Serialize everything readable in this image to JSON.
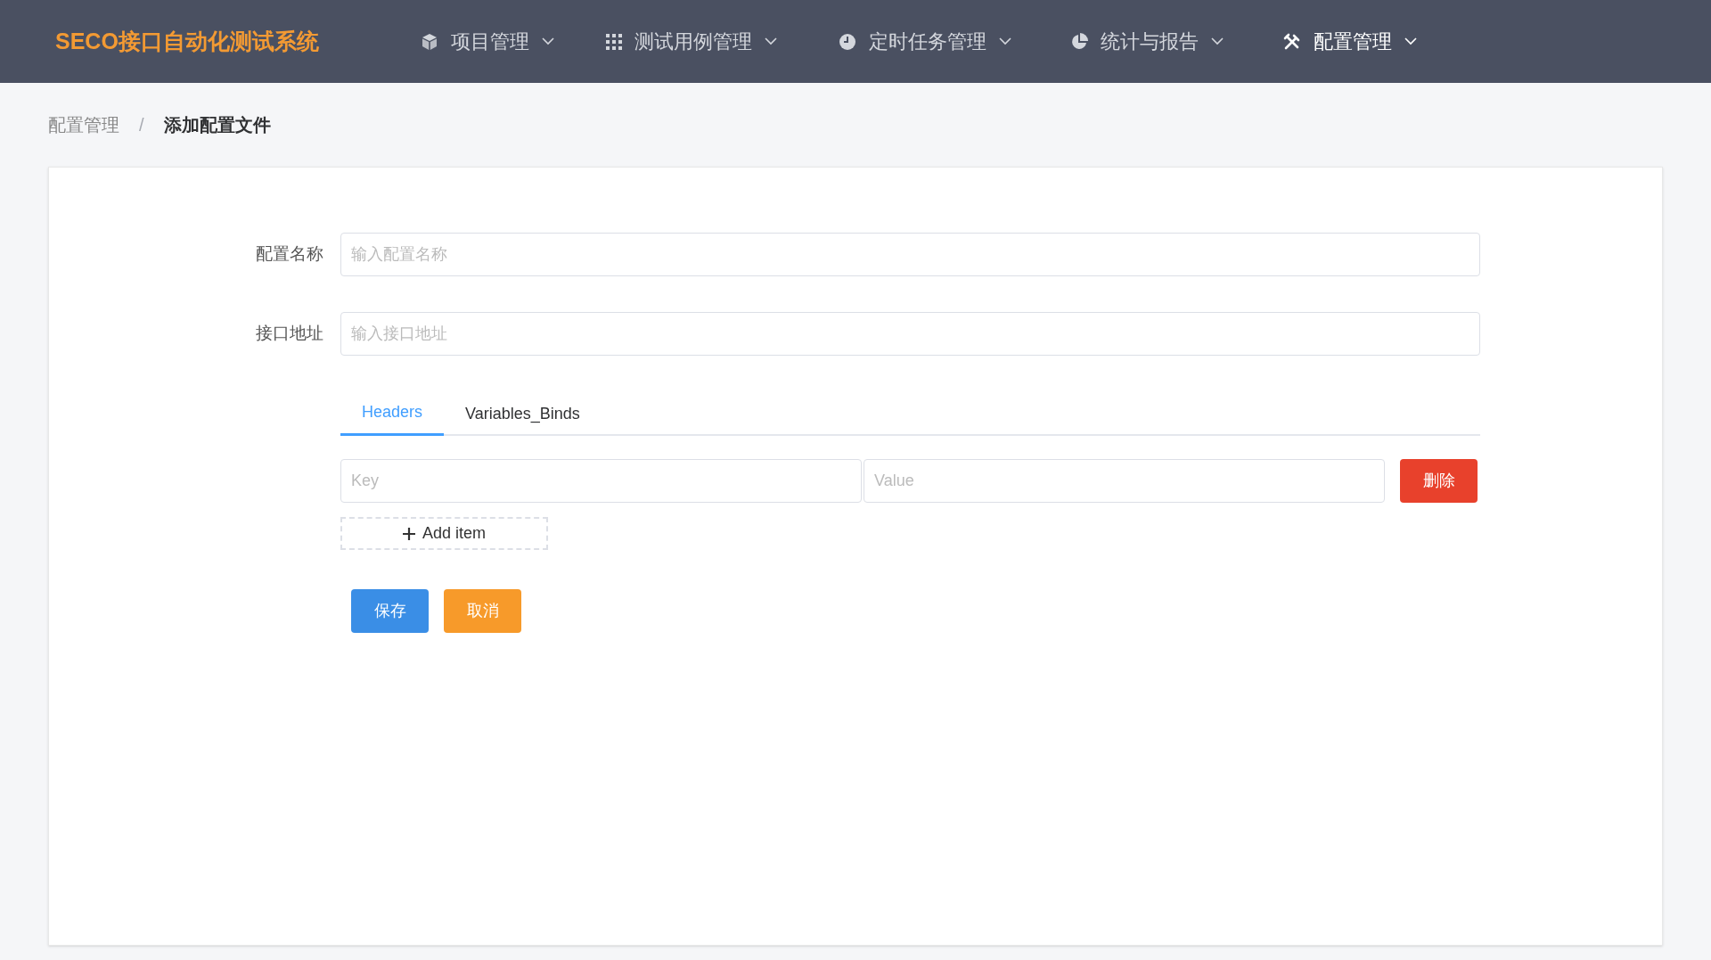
{
  "app_title": "SECO接口自动化测试系统",
  "nav": [
    {
      "kind": "cube",
      "label": "项目管理",
      "selected": false
    },
    {
      "kind": "grid",
      "label": "测试用例管理",
      "selected": false
    },
    {
      "kind": "clock",
      "label": "定时任务管理",
      "selected": false
    },
    {
      "kind": "pie",
      "label": "统计与报告",
      "selected": false
    },
    {
      "kind": "tools",
      "label": "配置管理",
      "selected": true
    }
  ],
  "breadcrumb": [
    "配置管理",
    "添加配置文件"
  ],
  "breadcrumb_separator": "/",
  "fields": [
    {
      "label": "配置名称",
      "placeholder": "输入配置名称"
    },
    {
      "label": "接口地址",
      "placeholder": "输入接口地址"
    }
  ],
  "tabs": [
    {
      "label": "Headers",
      "selected": true
    },
    {
      "label": "Variables_Binds",
      "selected": false
    }
  ],
  "rows": [
    {
      "key_placeholder": "Key",
      "value_placeholder": "Value",
      "delete": "删除"
    }
  ],
  "add_item": "Add item",
  "buttons": [
    {
      "kind": "primary",
      "label": "保存"
    },
    {
      "kind": "warning",
      "label": "取消"
    }
  ]
}
